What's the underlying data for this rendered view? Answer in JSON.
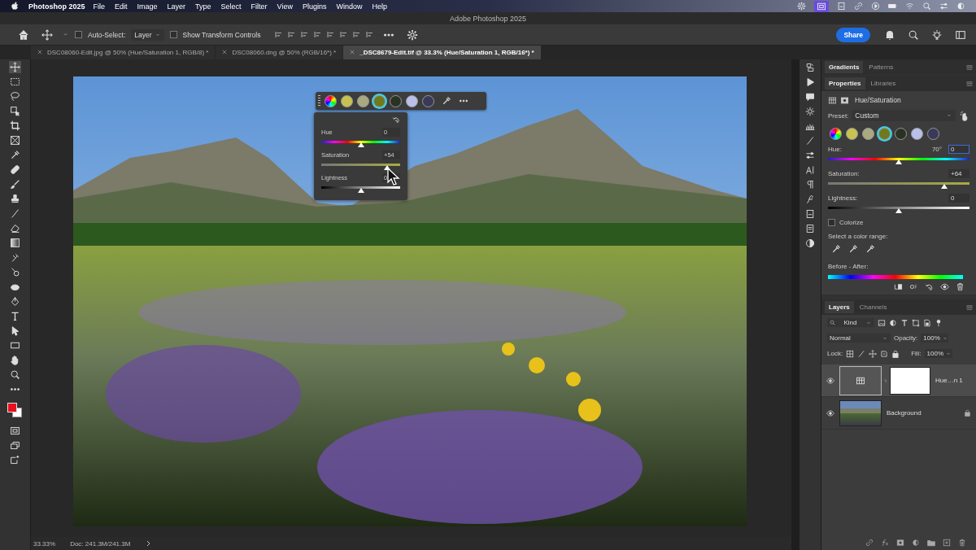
{
  "menu_bar": {
    "app": "Photoshop 2025",
    "items": [
      "File",
      "Edit",
      "Image",
      "Layer",
      "Type",
      "Select",
      "Filter",
      "View",
      "Plugins",
      "Window",
      "Help"
    ]
  },
  "window": {
    "title": "Adobe Photoshop 2025"
  },
  "options_bar": {
    "auto_select": {
      "label": "Auto-Select:",
      "checked": false
    },
    "target": "Layer",
    "show_transform": {
      "label": "Show Transform Controls",
      "checked": false
    },
    "share": "Share"
  },
  "document_tabs": [
    {
      "label": "DSC08060-Edit.jpg @ 50% (Hue/Saturation 1, RGB/8) *",
      "selected": false
    },
    {
      "label": "DSC08060.dng @ 50% (RGB/16*) *",
      "selected": false
    },
    {
      "label": "_DSC8679-Edit.tif @ 33.3% (Hue/Saturation 1, RGB/16*) *",
      "selected": true
    }
  ],
  "canvas_widget": {
    "swatches": [
      {
        "kind": "wheel",
        "selected": false
      },
      {
        "kind": "solid",
        "color": "#c8c250",
        "selected": false
      },
      {
        "kind": "solid",
        "color": "#a9a880",
        "selected": false
      },
      {
        "kind": "solid",
        "color": "#6e7a1c",
        "selected": true
      },
      {
        "kind": "solid",
        "color": "#2a3224",
        "selected": false
      },
      {
        "kind": "solid",
        "color": "#b9c1ea",
        "selected": false
      },
      {
        "kind": "solid",
        "color": "#3a3958",
        "selected": false
      }
    ],
    "sliders": [
      {
        "kind": "hue",
        "label": "Hue",
        "value": "0",
        "level": 0.5
      },
      {
        "kind": "saturation",
        "label": "Saturation",
        "value": "+54",
        "level": 0.83
      },
      {
        "kind": "lightness",
        "label": "Lightness",
        "value": "0",
        "level": 0.5
      }
    ]
  },
  "panel_tabs_top": [
    {
      "label": "Gradients",
      "selected": true
    },
    {
      "label": "Patterns",
      "selected": false
    }
  ],
  "panel_tabs_mid": [
    {
      "label": "Properties",
      "selected": true
    },
    {
      "label": "Libraries",
      "selected": false
    }
  ],
  "properties": {
    "title": "Hue/Saturation",
    "preset_label": "Preset:",
    "preset": "Custom",
    "swatches": [
      {
        "kind": "wheel",
        "selected": false
      },
      {
        "kind": "solid",
        "color": "#c8c250",
        "selected": false
      },
      {
        "kind": "solid",
        "color": "#a9a880",
        "selected": false
      },
      {
        "kind": "solid",
        "color": "#6e7a1c",
        "selected": true
      },
      {
        "kind": "solid",
        "color": "#2a3224",
        "selected": false
      },
      {
        "kind": "solid",
        "color": "#b9c1ea",
        "selected": false
      },
      {
        "kind": "solid",
        "color": "#3a3958",
        "selected": false
      }
    ],
    "sliders": [
      {
        "kind": "hue",
        "label": "Hue:",
        "reading": "70°",
        "value": "0",
        "level": 0.5
      },
      {
        "kind": "saturation",
        "label": "Saturation:",
        "value": "+64",
        "level": 0.82
      },
      {
        "kind": "lightness",
        "label": "Lightness:",
        "value": "0",
        "level": 0.5
      }
    ],
    "colorize": {
      "label": "Colorize",
      "checked": false
    },
    "color_range_label": "Select a color range:",
    "before_after_label": "Before - After:"
  },
  "layers_tabs": [
    {
      "label": "Layers",
      "selected": true
    },
    {
      "label": "Channels",
      "selected": false
    }
  ],
  "layers": {
    "filter": "Kind",
    "blend_mode": "Normal",
    "opacity_label": "Opacity:",
    "opacity": "100%",
    "lock_label": "Lock:",
    "fill_label": "Fill:",
    "fill": "100%",
    "items": [
      {
        "kind": "adjustment",
        "name": "Hue…n 1",
        "selected": true,
        "locked": false
      },
      {
        "kind": "image",
        "name": "Background",
        "selected": false,
        "locked": true
      }
    ]
  },
  "status_bar": {
    "zoom": "33.33%",
    "doc": "Doc: 241.3M/241.3M"
  }
}
